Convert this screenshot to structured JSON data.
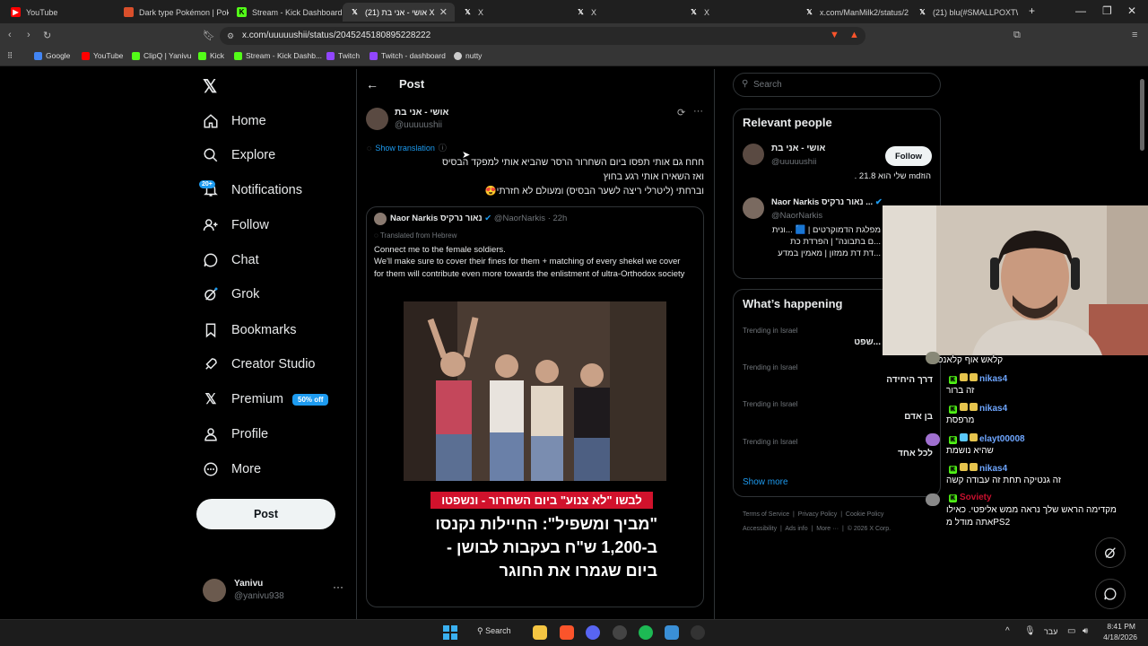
{
  "browser": {
    "tabs": [
      {
        "title": "YouTube",
        "favicon": "youtube-icon",
        "color": "#ff0000"
      },
      {
        "title": "Dark type Pokémon | Poké",
        "favicon": "pokemon-icon",
        "color": "#d94f2b"
      },
      {
        "title": "Stream - Kick Dashboard",
        "favicon": "kick-icon",
        "color": "#53fc18"
      },
      {
        "title": "אושי - אני בת (21) X",
        "favicon": "x-icon",
        "color": "#ffffff"
      },
      {
        "title": "X",
        "favicon": "x-icon",
        "color": "#ffffff"
      },
      {
        "title": "X",
        "favicon": "x-icon",
        "color": "#ffffff"
      },
      {
        "title": "X",
        "favicon": "x-icon",
        "color": "#ffffff"
      },
      {
        "title": "x.com/ManMilk2/status/2",
        "favicon": "x-icon",
        "color": "#ffffff"
      },
      {
        "title": "(21) blu(#SMALLPOXTWT",
        "favicon": "x-icon",
        "color": "#ffffff"
      }
    ],
    "url": "x.com/uuuuushii/status/2045245180895228222",
    "bookmarks": [
      {
        "label": "Google",
        "color": "#4285f4"
      },
      {
        "label": "YouTube",
        "color": "#ff0000"
      },
      {
        "label": "ClipQ | Yanivu",
        "color": "#53fc18"
      },
      {
        "label": "Kick",
        "color": "#53fc18"
      },
      {
        "label": "Stream - Kick Dashb...",
        "color": "#53fc18"
      },
      {
        "label": "Twitch",
        "color": "#9146ff"
      },
      {
        "label": "Twitch - dashboard",
        "color": "#9146ff"
      },
      {
        "label": "nutty",
        "color": "#cccccc"
      }
    ]
  },
  "nav": {
    "items": [
      {
        "label": "Home",
        "icon": "home-icon"
      },
      {
        "label": "Explore",
        "icon": "search-icon"
      },
      {
        "label": "Notifications",
        "icon": "bell-icon",
        "badge": "20+"
      },
      {
        "label": "Follow",
        "icon": "follow-icon"
      },
      {
        "label": "Chat",
        "icon": "chat-icon"
      },
      {
        "label": "Grok",
        "icon": "grok-icon"
      },
      {
        "label": "Bookmarks",
        "icon": "bookmark-icon"
      },
      {
        "label": "Creator Studio",
        "icon": "rocket-icon"
      },
      {
        "label": "Premium",
        "icon": "x-logo-icon",
        "badge": "50% off"
      },
      {
        "label": "Profile",
        "icon": "person-icon"
      },
      {
        "label": "More",
        "icon": "more-icon"
      }
    ],
    "post_button": "Post",
    "account": {
      "name": "Yanivu",
      "handle": "@yanivu938"
    }
  },
  "post": {
    "header_title": "Post",
    "author_name": "אושי - אני בת",
    "author_handle": "@uuuuushii",
    "show_translation": "Show translation",
    "text_lines": [
      "חחח גם אותי תפסו ביום השחרור הרסר שהביא אותי למפקד הבסיס",
      "ואז השאירו אותי רגע בחוץ",
      "וברחתי (ליטרלי ריצה לשער הבסיס) ומעולם לא חזרתי😍"
    ],
    "quote": {
      "author_name": "Naor Narkis נאור נרקיס",
      "author_handle": "@NaorNarkis",
      "time": "· 22h",
      "translated_note": "Translated from Hebrew",
      "text": "Connect me to the female soldiers.\nWe'll make sure to cover their fines for them + matching of every shekel we cover for them will contribute even more towards the enlistment of ultra-Orthodox society",
      "image_banner": "לבשו \"לא צנוע\" ביום השחרור - ונשפטו",
      "image_headline_1": "\"מביך ומשפיל\": החיילות נקנסו",
      "image_headline_2": "ב-1,200 ש\"ח בעקבות לבושן -",
      "image_headline_3": "ביום שגמרו את החוגר"
    }
  },
  "right": {
    "search_placeholder": "Search",
    "relevant_title": "Relevant people",
    "people": [
      {
        "name": "אושי - אני בת",
        "handle": "@uuuuushii",
        "bio": "הוזmd שלי הוא 21.8 .",
        "follow": "Follow"
      },
      {
        "name": "Naor Narkis נאור נרקיס ...",
        "handle": "@NaorNarkis",
        "bio_1": "מפלגת הדמוקרטים | 🟦 ...ונית",
        "bio_2": "...ם בתבונה\" | הפרדת כת",
        "bio_3": "...דת דת ממזון | מאמין במדע"
      }
    ],
    "happening_title": "What’s happening",
    "trends": [
      {
        "label": "Trending in Israel",
        "name": "...שפט"
      },
      {
        "label": "Trending in Israel",
        "name": "דרך היחידה"
      },
      {
        "label": "Trending in Israel",
        "name": "בן אדם"
      },
      {
        "label": "Trending in Israel",
        "name": "לכל אחד"
      }
    ],
    "show_more": "Show more",
    "footer_1": [
      "Terms of Service",
      "Privacy Policy",
      "Cookie Policy"
    ],
    "footer_2": [
      "Accessibility",
      "Ads info",
      "More ···",
      "© 2026 X Corp."
    ]
  },
  "chat": [
    {
      "user": "",
      "msg": "קלאש אוף קלאנס"
    },
    {
      "user": "nikas4",
      "msg": "זה ברור"
    },
    {
      "user": "nikas4",
      "msg": "מרפסת"
    },
    {
      "user": "elayt00008",
      "msg": "שהיא נושמת"
    },
    {
      "user": "nikas4",
      "msg": "זה גנטיקה תחת זה עבודה קשה"
    },
    {
      "user": "Soviety",
      "msg": "מקדימה הראש שלך נראה ממש אליפטי. כאילו",
      "msg2": "PS2אתה מודל מ"
    }
  ],
  "taskbar": {
    "search": "Search",
    "lang": "עבר",
    "time": "8:41 PM",
    "date": "4/18/2026"
  },
  "colors": {
    "accent": "#1d9bf0",
    "background": "#000000",
    "border": "#2f3336",
    "muted": "#71767b",
    "kick_green": "#53fc18"
  }
}
